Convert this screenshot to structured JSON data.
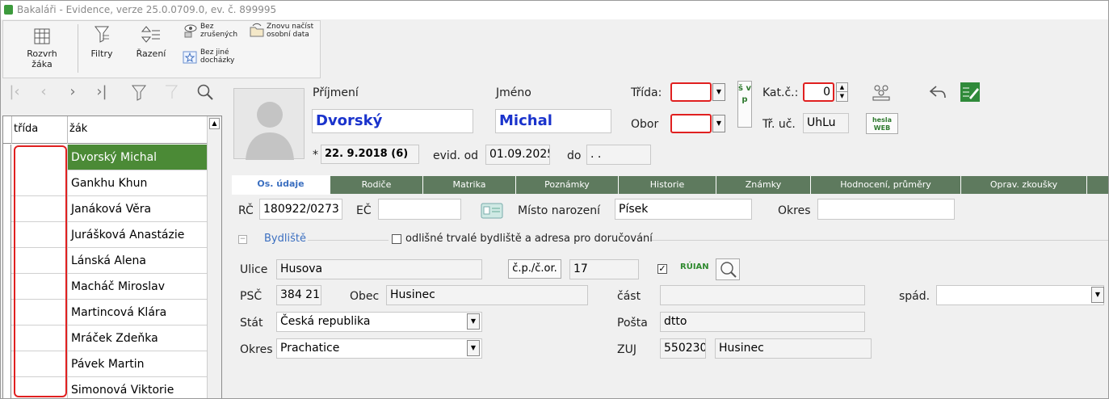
{
  "window": {
    "title": "Bakaláři - Evidence, verze 25.0.0709.0, ev. č. 899995"
  },
  "ribbon": {
    "timetable": "Rozvrh\nžáka",
    "filters": "Filtry",
    "sort": "Řazení",
    "without_cancelled": "Bez\nzrušených",
    "reload_personal": "Znovu načíst\nosobní data",
    "without_other_attendance": "Bez jiné\ndocházky"
  },
  "grid": {
    "col_class": "třída",
    "col_student": "žák",
    "rows": [
      {
        "name": "Dvorský Michal",
        "selected": true
      },
      {
        "name": "Gankhu Khun"
      },
      {
        "name": "Janáková Věra"
      },
      {
        "name": "Jurášková Anastázie"
      },
      {
        "name": "Lánská Alena"
      },
      {
        "name": "Macháč Miroslav"
      },
      {
        "name": "Martincová Klára"
      },
      {
        "name": "Mráček Zdeňka"
      },
      {
        "name": "Pávek Martin"
      },
      {
        "name": "Simonová Viktorie"
      }
    ]
  },
  "student": {
    "surname_label": "Příjmení",
    "surname": "Dvorský",
    "name_label": "Jméno",
    "name": "Michal",
    "class_label": "Třída:",
    "class": "",
    "field_label": "Obor",
    "field": "",
    "svp_label": "š v p",
    "catalog_label": "Kat.č.:",
    "catalog": "0",
    "teacher_label": "Tř. uč.",
    "teacher": "UhLu",
    "web_pw_label": "hesla WEB",
    "birth_star": "*",
    "birth": "22. 9.2018 (6)",
    "evid_from_label": "evid. od",
    "evid_from": "01.09.2025",
    "to_label": "do",
    "to": ". ."
  },
  "tabs": [
    "Os. údaje",
    "Rodiče",
    "Matrika",
    "Poznámky",
    "Historie",
    "Známky",
    "Hodnocení, průměry",
    "Oprav. zkoušky"
  ],
  "personal": {
    "rc_label": "RČ",
    "rc": "180922/0273",
    "ec_label": "EČ",
    "ec": "",
    "birthplace_label": "Místo narození",
    "birthplace": "Písek",
    "district_label": "Okres",
    "district": "",
    "residence_label": "Bydliště",
    "different_address": "odlišné trvalé bydliště a adresa pro doručování",
    "street_label": "Ulice",
    "street": "Husova",
    "cp_button": "č.p./č.or.",
    "cp": "17",
    "ruian_checked": "✓",
    "ruian_label": "RÚIAN",
    "psc_label": "PSČ",
    "psc": "384 21",
    "city_label": "Obec",
    "city": "Husinec",
    "part_label": "část",
    "part": "",
    "spad_label": "spád.",
    "spad": "",
    "state_label": "Stát",
    "state": "Česká republika",
    "post_label": "Pošta",
    "post": "dtto",
    "okres_label": "Okres",
    "okres": "Prachatice",
    "zuj_label": "ZUJ",
    "zuj_code": "550230",
    "zuj_name": "Husinec"
  }
}
